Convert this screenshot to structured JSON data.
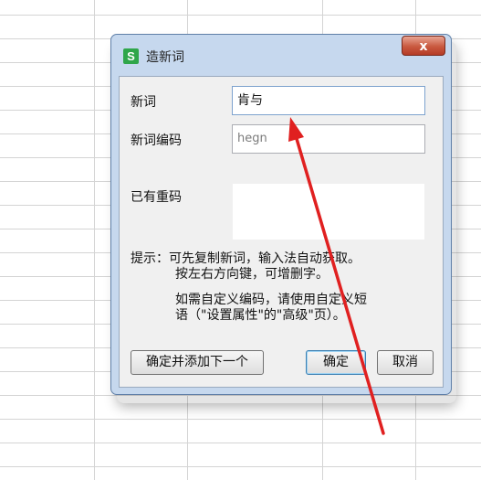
{
  "dialog": {
    "title": "造新词",
    "app_icon_letter": "S",
    "close_glyph": "x",
    "word_label": "新词",
    "word_value": "肯与",
    "code_label": "新词编码",
    "code_value": "hegn",
    "existing_label": "已有重码",
    "existing_value": "",
    "tip_line1": "提示：可先复制新词，输入法自动获取。",
    "tip_line2": "按左右方向键，可增删字。",
    "tip_line3": "如需自定义编码，请使用自定义短",
    "tip_line4": "语（\"设置属性\"的\"高级\"页）。",
    "buttons": {
      "confirm_add_next": "确定并添加下一个",
      "confirm": "确定",
      "cancel": "取消"
    }
  },
  "annotation": {
    "arrow_color": "#e02020"
  }
}
